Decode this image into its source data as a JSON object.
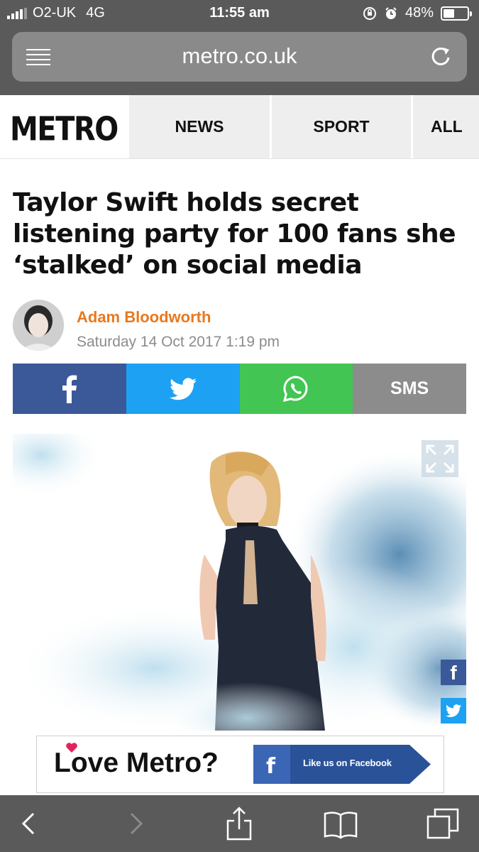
{
  "status_bar": {
    "carrier": "O2-UK",
    "network": "4G",
    "time": "11:55 am",
    "battery": "48%",
    "battery_level": 0.48
  },
  "browser": {
    "url": "metro.co.uk"
  },
  "site_nav": {
    "logo": "METRO",
    "tabs": [
      "NEWS",
      "SPORT",
      "ALL"
    ]
  },
  "article": {
    "headline": "Taylor Swift holds secret listening party for 100 fans she ‘stalked’ on social media",
    "author": "Adam Bloodworth",
    "date": "Saturday 14 Oct 2017 1:19 pm"
  },
  "share": {
    "facebook_icon": "facebook-icon",
    "twitter_icon": "twitter-icon",
    "whatsapp_icon": "whatsapp-icon",
    "sms_label": "SMS"
  },
  "ad": {
    "text": "Love Metro?",
    "fb_button": "Like us on Facebook"
  },
  "colors": {
    "facebook": "#3b5998",
    "twitter": "#1da1f2",
    "whatsapp": "#43c553",
    "sms": "#8c8c8c",
    "author": "#e8791e"
  }
}
